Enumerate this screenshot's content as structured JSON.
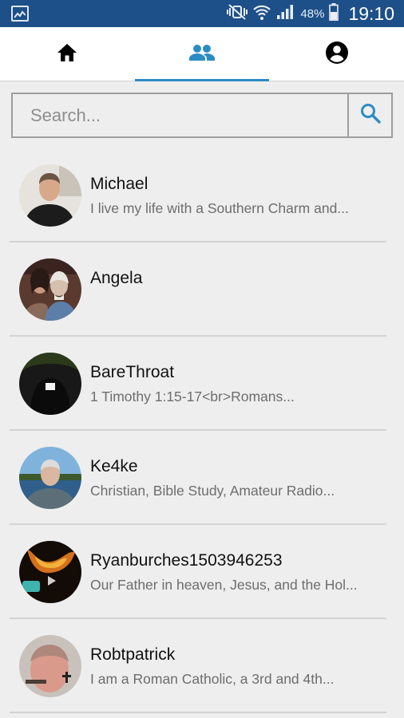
{
  "status_bar": {
    "battery_percent": "48%",
    "time": "19:10",
    "icons": [
      "gallery-icon",
      "mute-vibrate-icon",
      "wifi-icon",
      "signal-icon",
      "battery-icon"
    ]
  },
  "tabs": [
    {
      "icon": "home-icon",
      "selected": false
    },
    {
      "icon": "people-icon",
      "selected": true
    },
    {
      "icon": "account-icon",
      "selected": false
    }
  ],
  "search": {
    "placeholder": "Search...",
    "value": ""
  },
  "colors": {
    "status_bar": "#1d4f88",
    "accent": "#2b8cc4",
    "background": "#eeeeee"
  },
  "users": [
    {
      "name": "Michael",
      "description": "I live my life with a Southern Charm and..."
    },
    {
      "name": "Angela",
      "description": ""
    },
    {
      "name": "BareThroat",
      "description": "1 Timothy 1:15-17<br>Romans..."
    },
    {
      "name": "Ke4ke",
      "description": "Christian, Bible Study, Amateur Radio..."
    },
    {
      "name": "Ryanburches1503946253",
      "description": "Our Father in heaven, Jesus, and the Hol..."
    },
    {
      "name": "Robtpatrick",
      "description": "I am a Roman Catholic,  a 3rd and 4th..."
    }
  ]
}
